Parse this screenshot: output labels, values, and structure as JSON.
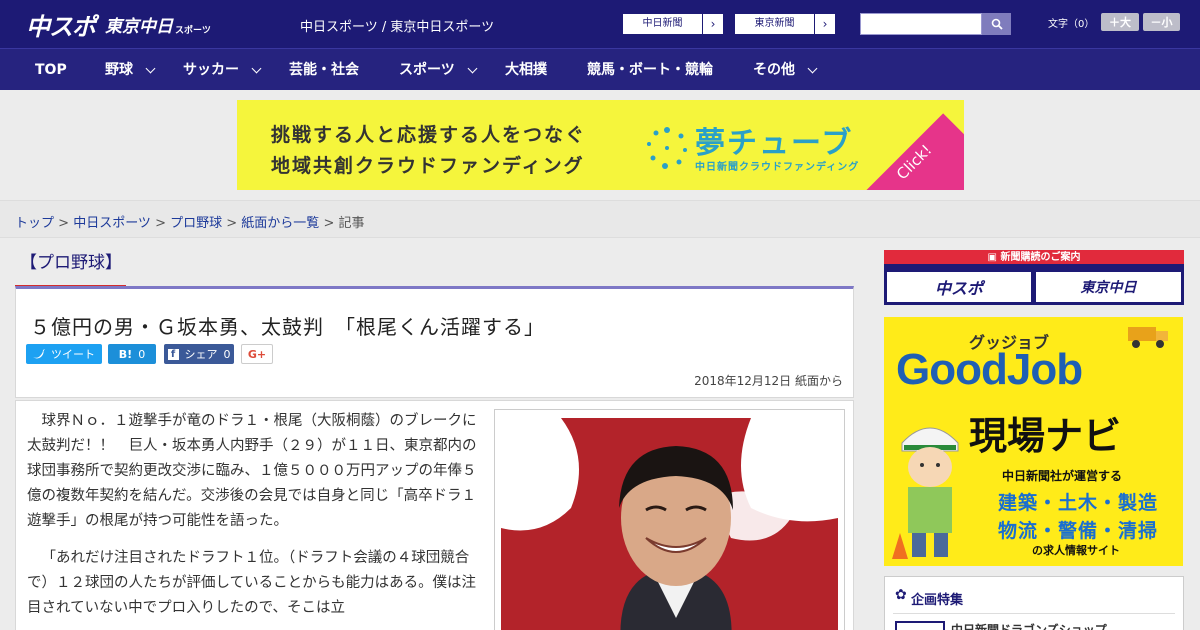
{
  "header": {
    "logo_main": "中スポ",
    "logo_tokyo": "東京中日",
    "logo_sports": "スポーツ",
    "site_name": "中日スポーツ / 東京中日スポーツ",
    "paper_buttons": [
      "中日新聞",
      "東京新聞"
    ],
    "search_placeholder": "",
    "font_label": "文字（0）",
    "font_larger": "＋大",
    "font_smaller": "－小"
  },
  "nav": {
    "items": [
      {
        "label": "TOP",
        "dropdown": false
      },
      {
        "label": "野球",
        "dropdown": true
      },
      {
        "label": "サッカー",
        "dropdown": true
      },
      {
        "label": "芸能・社会",
        "dropdown": false
      },
      {
        "label": "スポーツ",
        "dropdown": true
      },
      {
        "label": "大相撲",
        "dropdown": false
      },
      {
        "label": "競馬・ボート・競輪",
        "dropdown": false
      },
      {
        "label": "その他",
        "dropdown": true
      }
    ]
  },
  "banner": {
    "line1": "挑戦する人と応援する人をつなぐ",
    "line2": "地域共創クラウドファンディング",
    "brand": "夢チューブ",
    "brand_sub": "中日新聞クラウドファンディング",
    "click": "Click!",
    "colors": {
      "bg": "#f5f53c",
      "brand": "#2aa0c8",
      "click": "#e6348a"
    }
  },
  "breadcrumb": {
    "items": [
      "トップ",
      "中日スポーツ",
      "プロ野球",
      "紙面から一覧"
    ],
    "current": "記事",
    "sep": " > "
  },
  "article": {
    "category": "【プロ野球】",
    "headline": "５億円の男・Ｇ坂本勇、太鼓判　「根尾くん活躍する」",
    "share": {
      "tweet": "ツイート",
      "hatena": "B!",
      "hatena_count": "0",
      "facebook": "シェア",
      "facebook_count": "0",
      "gplus": "G+"
    },
    "date": "2018年12月12日 紙面から",
    "paragraphs": [
      "球界Ｎｏ．１遊撃手が竜のドラ１・根尾（大阪桐蔭）のブレークに太鼓判だ！！　巨人・坂本勇人内野手（２９）が１１日、東京都内の球団事務所で契約更改交渉に臨み、１億５０００万円アップの年俸５億の複数年契約を結んだ。交渉後の会見では自身と同じ「高卒ドラ１遊撃手」の根尾が持つ可能性を語った。",
      "「あれだけ注目されたドラフト１位。（ドラフト会議の４球団競合で）１２球団の人たちが評価していることからも能力はある。僕は注目されていない中でプロ入りしたので、そこは立"
    ]
  },
  "sidebar": {
    "subscribe_title": "新聞購読のご案内",
    "subscribe_buttons": [
      "中スポ",
      "東京中日"
    ],
    "goodjob": {
      "catch": "グッジョブ",
      "title": "GoodJob",
      "navi": "現場ナビ",
      "sub": "中日新聞社が運営する",
      "list1": "建築・土木・製造",
      "list2": "物流・警備・清掃",
      "foot": "の求人情報サイト"
    },
    "feature_title": "企画特集",
    "feature_item": "中日新聞ドラゴンズショップ"
  }
}
